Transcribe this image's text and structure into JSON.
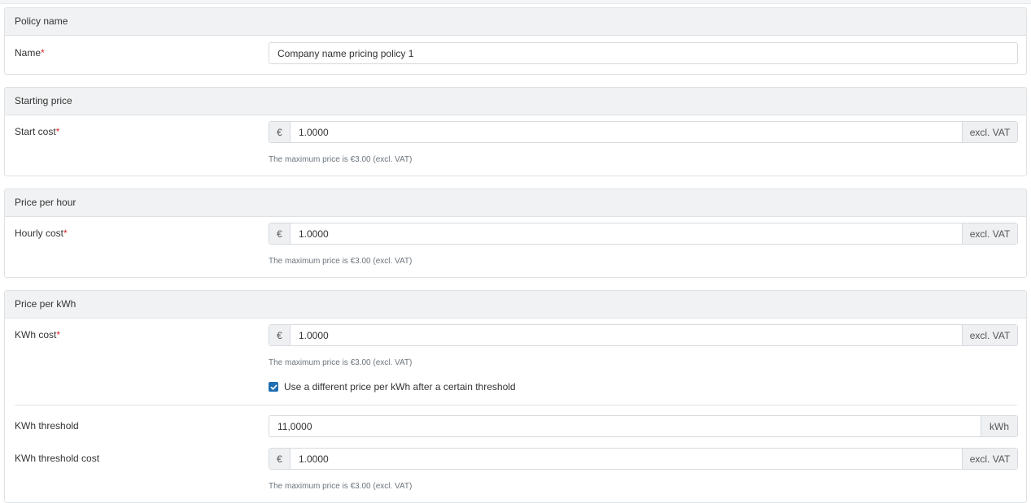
{
  "sections": {
    "policy_name": {
      "title": "Policy name",
      "name_label": "Name",
      "required_mark": "*",
      "name_value": "Company name pricing policy 1"
    },
    "starting_price": {
      "title": "Starting price",
      "label": "Start cost",
      "required_mark": "*",
      "currency": "€",
      "value": "1.0000",
      "suffix": "excl. VAT",
      "help": "The maximum price is €3.00 (excl. VAT)"
    },
    "price_per_hour": {
      "title": "Price per hour",
      "label": "Hourly cost",
      "required_mark": "*",
      "currency": "€",
      "value": "1.0000",
      "suffix": "excl. VAT",
      "help": "The maximum price is €3.00 (excl. VAT)"
    },
    "price_per_kwh": {
      "title": "Price per kWh",
      "label": "KWh cost",
      "required_mark": "*",
      "currency": "€",
      "value": "1.0000",
      "suffix": "excl. VAT",
      "help": "The maximum price is €3.00 (excl. VAT)",
      "threshold_checkbox": {
        "label": "Use a different price per kWh after a certain threshold",
        "checked": true
      },
      "threshold": {
        "label": "KWh threshold",
        "value": "11,0000",
        "suffix": "kWh"
      },
      "threshold_cost": {
        "label": "KWh threshold cost",
        "currency": "€",
        "value": "1.0000",
        "suffix": "excl. VAT",
        "help": "The maximum price is €3.00 (excl. VAT)"
      }
    }
  },
  "colors": {
    "accent": "#1f6fb2",
    "required": "#d9292e",
    "header_bg": "#f1f2f3",
    "border": "#dfe2e5"
  },
  "icons": {
    "checkbox": "check-icon"
  }
}
